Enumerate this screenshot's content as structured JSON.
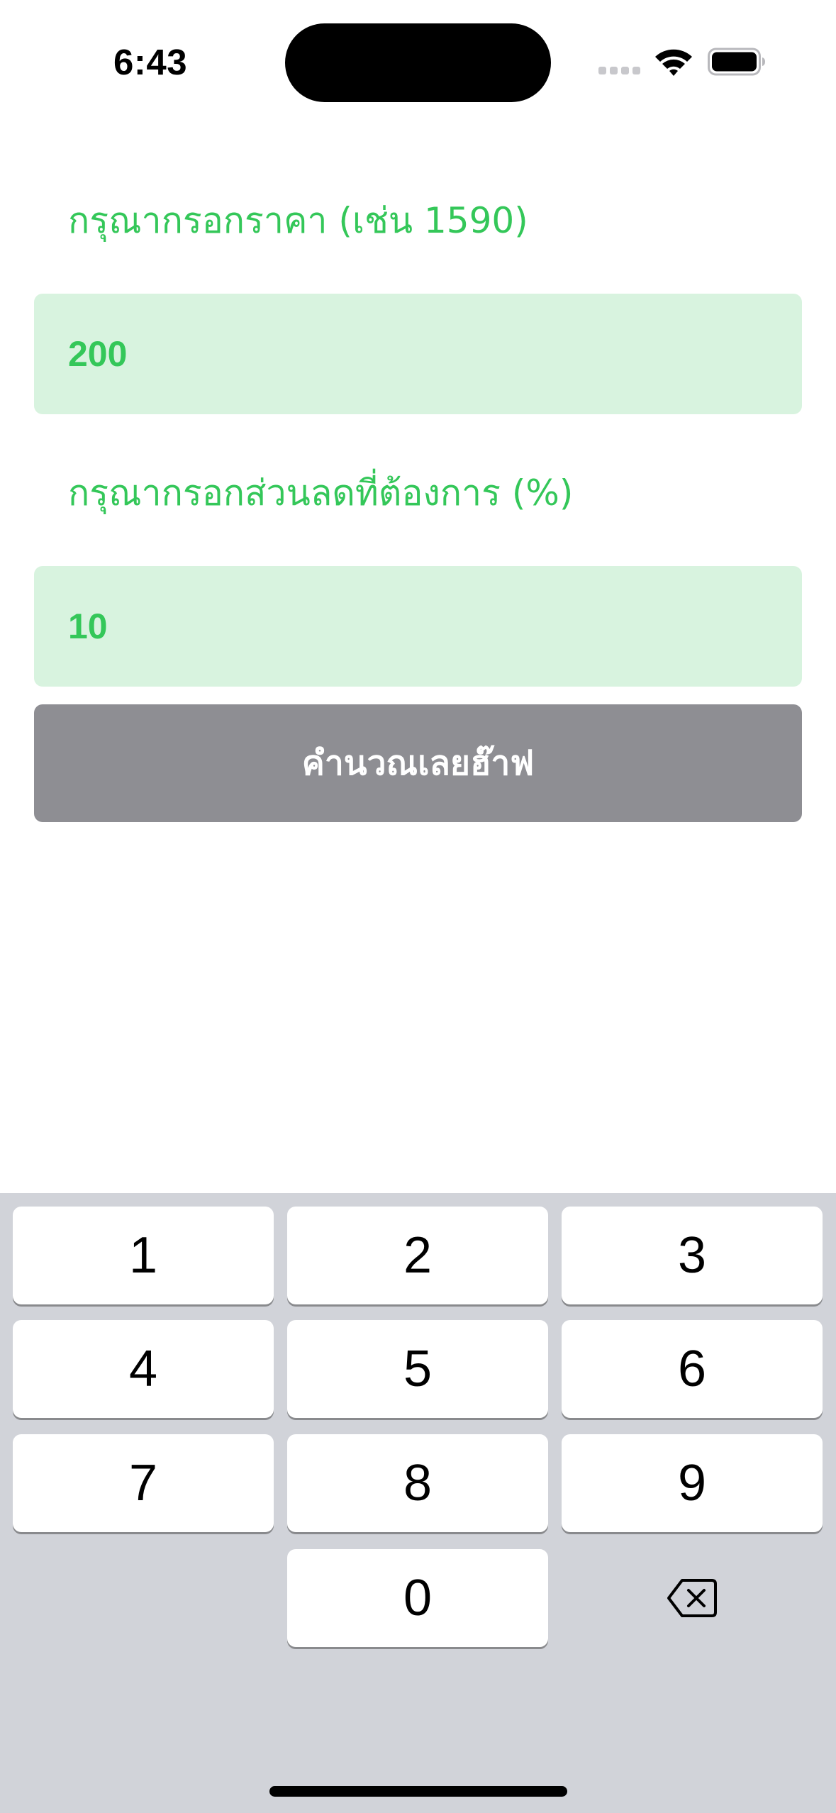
{
  "status_bar": {
    "time": "6:43",
    "icons": [
      "cellular-signal-icon",
      "wifi-icon",
      "battery-icon"
    ]
  },
  "form": {
    "price_label": "กรุณากรอกราคา (เช่น 1590)",
    "price_value": "200",
    "discount_label": "กรุณากรอกส่วนลดที่ต้องการ (%)",
    "discount_value": "10",
    "calculate_button_label": "คำนวณเลยฮ๊าฟ"
  },
  "keypad": {
    "keys": [
      "1",
      "2",
      "3",
      "4",
      "5",
      "6",
      "7",
      "8",
      "9",
      "0"
    ],
    "delete_icon": "delete-backspace-icon"
  },
  "colors": {
    "accent_green": "#34c759",
    "input_background": "#d8f3df",
    "button_background": "#8e8e93",
    "keyboard_background": "#d1d3d9"
  }
}
